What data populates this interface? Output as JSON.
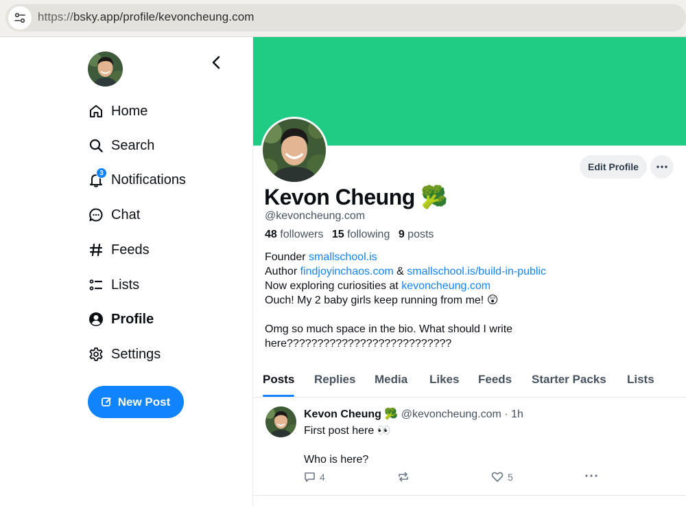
{
  "browser": {
    "url_scheme": "https://",
    "url_rest": "bsky.app/profile/kevoncheung.com"
  },
  "sidebar": {
    "nav": [
      {
        "label": "Home",
        "icon": "home-icon"
      },
      {
        "label": "Search",
        "icon": "search-icon"
      },
      {
        "label": "Notifications",
        "icon": "bell-icon",
        "badge": "3"
      },
      {
        "label": "Chat",
        "icon": "chat-bubble-icon"
      },
      {
        "label": "Feeds",
        "icon": "hash-icon"
      },
      {
        "label": "Lists",
        "icon": "list-icon"
      },
      {
        "label": "Profile",
        "icon": "profile-icon",
        "active": true
      },
      {
        "label": "Settings",
        "icon": "gear-icon"
      }
    ],
    "new_post_label": "New Post"
  },
  "profile": {
    "display_name": "Kevon Cheung",
    "name_emoji": "🥦",
    "handle": "@kevoncheung.com",
    "followers_count": "48",
    "followers_label": "followers",
    "following_count": "15",
    "following_label": "following",
    "posts_count": "9",
    "posts_label": "posts",
    "edit_profile_label": "Edit Profile",
    "banner_color": "#20cb84",
    "bio": {
      "line1_text": "Founder ",
      "line1_link": "smallschool.is",
      "line2_text": "Author ",
      "line2_link1": "findjoyinchaos.com",
      "line2_sep": " & ",
      "line2_link2": "smallschool.is/build-in-public",
      "line3_text": "Now exploring curiosities at ",
      "line3_link": "kevoncheung.com",
      "line4_text": "Ouch! My 2 baby girls keep running from me! 😲",
      "line5_text": "Omg so much space in the bio. What should I write",
      "line6_text": "here???????????????????????????"
    }
  },
  "tabs": [
    "Posts",
    "Replies",
    "Media",
    "Likes",
    "Feeds",
    "Starter Packs",
    "Lists"
  ],
  "post": {
    "author_name": "Kevon Cheung",
    "author_emoji": "🥦",
    "author_handle": "@kevoncheung.com",
    "time": "· 1h",
    "line1": "First post here 👀",
    "line2": "Who is here?",
    "reply_count": "4",
    "like_count": "5"
  },
  "colors": {
    "accent": "#1083fe",
    "banner": "#20cb84"
  }
}
